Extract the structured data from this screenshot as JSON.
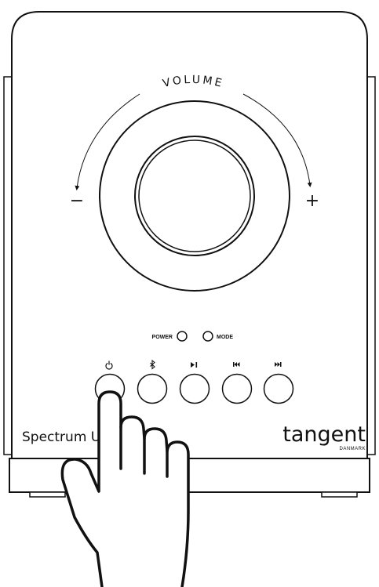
{
  "device": {
    "volume_label": "VOLUME",
    "minus_sign": "−",
    "plus_sign": "+",
    "indicators": {
      "power_label": "POWER",
      "mode_label": "MODE"
    },
    "buttons": [
      {
        "name": "power-button",
        "icon": "power-icon"
      },
      {
        "name": "bluetooth-button",
        "icon": "bluetooth-icon"
      },
      {
        "name": "play-pause-button",
        "icon": "play-pause-icon"
      },
      {
        "name": "previous-button",
        "icon": "previous-track-icon"
      },
      {
        "name": "next-button",
        "icon": "next-track-icon"
      }
    ],
    "model_name": "Spectrum U",
    "brand": {
      "logo_text": "tangent",
      "logo_sub": "DANMARK"
    }
  },
  "illustration": {
    "hand": "hand-pressing-power-button"
  }
}
